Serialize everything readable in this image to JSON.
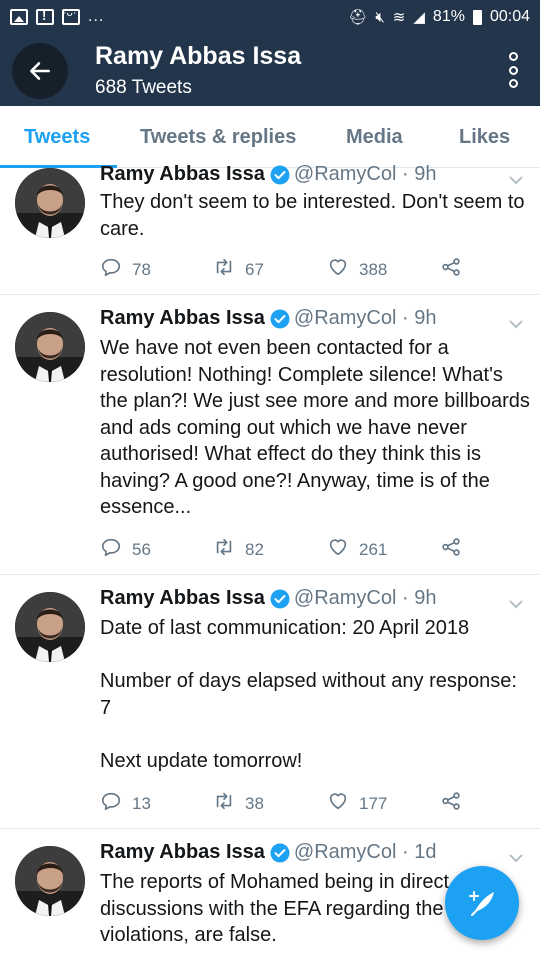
{
  "status_bar": {
    "left_icons": [
      "image-icon",
      "alert-icon",
      "face-icon"
    ],
    "dots": "...",
    "right_icons": [
      "android-icon",
      "mute-icon",
      "wifi-icon",
      "signal-icon"
    ],
    "battery": "81%",
    "time": "00:04"
  },
  "header": {
    "name": "Ramy Abbas Issa",
    "tweet_count": "688 Tweets"
  },
  "tabs": [
    "Tweets",
    "Tweets & replies",
    "Media",
    "Likes"
  ],
  "tweets": [
    {
      "name": "Ramy Abbas Issa",
      "handle_time": "@RamyCol · 9h",
      "text": "They don't seem to be interested. Don't seem to care.",
      "replies": "78",
      "retweets": "67",
      "likes": "388"
    },
    {
      "name": "Ramy Abbas Issa",
      "handle_time": "@RamyCol · 9h",
      "text": "We have not even been contacted for a resolution! Nothing! Complete silence! What's the plan?! We just see more and more billboards and ads coming out which we have never authorised! What effect do they think this is having? A good one?! Anyway, time is of the essence...",
      "replies": "56",
      "retweets": "82",
      "likes": "261"
    },
    {
      "name": "Ramy Abbas Issa",
      "handle_time": "@RamyCol · 9h",
      "text": "Date of last communication: 20 April 2018\n\nNumber of days elapsed without any response: 7\n\nNext update tomorrow!",
      "replies": "13",
      "retweets": "38",
      "likes": "177"
    },
    {
      "name": "Ramy Abbas Issa",
      "handle_time": "@RamyCol · 1d",
      "text": "The reports of Mohamed being in direct discussions with the EFA regarding the rights violations, are false."
    }
  ],
  "colors": {
    "header_bg": "#23354a",
    "accent": "#1da1f2",
    "muted": "#657786"
  }
}
